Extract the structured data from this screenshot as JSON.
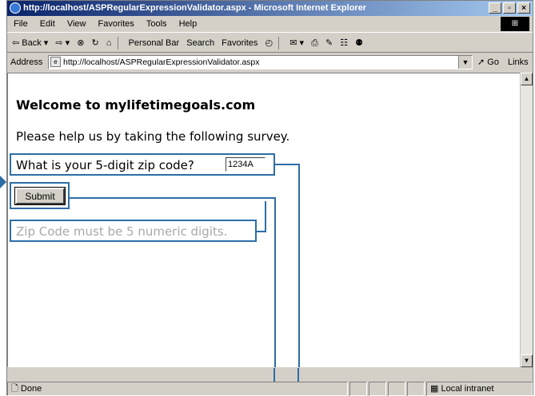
{
  "window": {
    "title": "http://localhost/ASPRegularExpressionValidator.aspx - Microsoft Internet Explorer",
    "controls": [
      "_",
      "0",
      "X"
    ]
  },
  "menu": [
    "File",
    "Edit",
    "View",
    "Favorites",
    "Tools",
    "Help"
  ],
  "toolbar": {
    "back": "⇦ Back ▾",
    "forward": "⇨ ▾",
    "stop": "⊗",
    "refresh": "↻",
    "home": "⌂",
    "personal_bar": "Personal Bar",
    "search": "Search",
    "favorites": "Favorites",
    "history": "◴",
    "mail": "✉ ▾",
    "print": "⎙",
    "edit": "✎",
    "discuss": "☷",
    "messenger": "⚉"
  },
  "address": {
    "label": "Address",
    "url": "http://localhost/ASPRegularExpressionValidator.aspx",
    "go": "Go",
    "links": "Links »"
  },
  "page": {
    "title": "Welcome to mylifetimegoals.com",
    "intro": "Please help us by taking the following survey.",
    "zip_label": "What is your 5-digit zip code?",
    "zip_value": "1234A",
    "submit_label": "Submit",
    "error_message": "Zip Code must be 5 numeric digits."
  },
  "status": {
    "text": "Done",
    "zone": "Local intranet"
  },
  "colors": {
    "callout": "#2d6ea6",
    "error_text": "#a9a9a9"
  }
}
